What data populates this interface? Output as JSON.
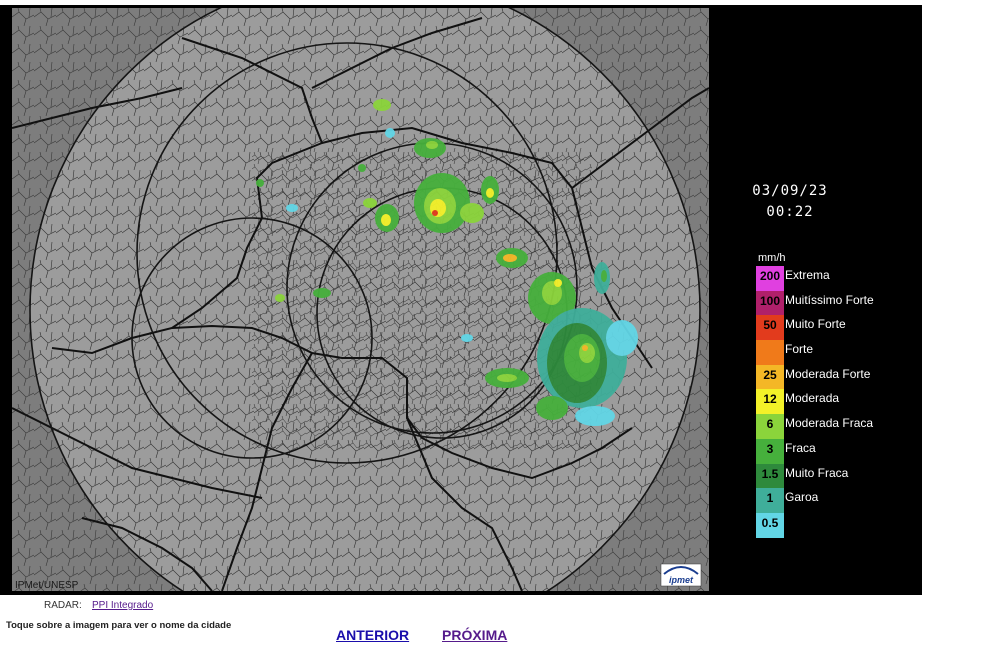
{
  "radar_image": {
    "timestamp_date": "03/09/23",
    "timestamp_time": "00:22",
    "credit": "IPMet/UNESP",
    "logo_text": "ipmet",
    "legend_unit": "mm/h",
    "legend": [
      {
        "value": "200",
        "label": "Extrema",
        "color": "#e040e0"
      },
      {
        "value": "100",
        "label": "Muitíssimo Forte",
        "color": "#b0206a"
      },
      {
        "value": "50",
        "label": "Muito Forte",
        "color": "#e23b1d"
      },
      {
        "value": "",
        "label": "Forte",
        "color": "#f07a1a"
      },
      {
        "value": "25",
        "label": "Moderada Forte",
        "color": "#f4b726"
      },
      {
        "value": "12",
        "label": "Moderada",
        "color": "#f3f128"
      },
      {
        "value": "6",
        "label": "Moderada Fraca",
        "color": "#8bd43b"
      },
      {
        "value": "3",
        "label": "Fraca",
        "color": "#46b03c"
      },
      {
        "value": "1.5",
        "label": "Muito Fraca",
        "color": "#2e8a3c"
      },
      {
        "value": "1",
        "label": "Garoa",
        "color": "#3fae9a"
      },
      {
        "value": "0.5",
        "label": "",
        "color": "#62d6e6"
      }
    ]
  },
  "footer": {
    "radar_label": "RADAR:",
    "radar_link": "PPI Integrado",
    "hint": "Toque sobre a imagem para ver o nome da cidade",
    "prev": "ANTERIOR",
    "next": "PRÓXIMA"
  }
}
